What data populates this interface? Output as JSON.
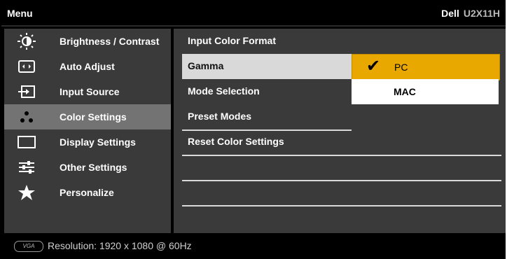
{
  "header": {
    "menu_title": "Menu",
    "brand": "Dell",
    "model": "U2X11H"
  },
  "sidebar": {
    "items": [
      {
        "label": "Brightness / Contrast",
        "icon": "brightness-icon",
        "active": false
      },
      {
        "label": "Auto Adjust",
        "icon": "auto-adjust-icon",
        "active": false
      },
      {
        "label": "Input Source",
        "icon": "input-source-icon",
        "active": false
      },
      {
        "label": "Color Settings",
        "icon": "color-settings-icon",
        "active": true
      },
      {
        "label": "Display Settings",
        "icon": "display-settings-icon",
        "active": false
      },
      {
        "label": "Other Settings",
        "icon": "other-settings-icon",
        "active": false
      },
      {
        "label": "Personalize",
        "icon": "star-icon",
        "active": false
      }
    ]
  },
  "color_settings": {
    "rows": [
      {
        "label": "Input Color Format",
        "selected": false
      },
      {
        "label": "Gamma",
        "selected": true
      },
      {
        "label": "Mode Selection",
        "selected": false
      },
      {
        "label": "Preset Modes",
        "selected": false
      },
      {
        "label": "Reset Color Settings",
        "selected": false
      }
    ],
    "gamma_options": [
      {
        "label": "PC",
        "checked": true
      },
      {
        "label": "MAC",
        "checked": false
      }
    ]
  },
  "footer": {
    "input_badge": "VGA",
    "resolution": "Resolution: 1920 x 1080 @ 60Hz"
  },
  "colors": {
    "highlight": "#e8a800",
    "active_nav": "#737373",
    "panel": "#3a3a3a",
    "selected_row": "#d9d9d9"
  }
}
